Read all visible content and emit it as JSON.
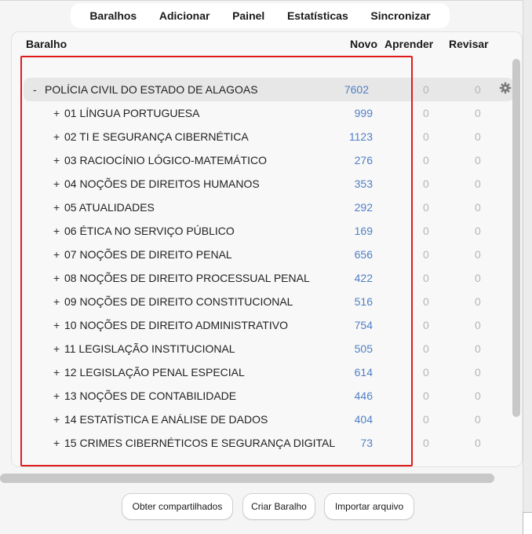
{
  "toolbar": {
    "items": [
      "Baralhos",
      "Adicionar",
      "Painel",
      "Estatísticas",
      "Sincronizar"
    ]
  },
  "table": {
    "headers": {
      "deck": "Baralho",
      "new": "Novo",
      "learn": "Aprender",
      "review": "Revisar"
    },
    "parent": {
      "toggle": "-",
      "name": "POLÍCIA CIVIL DO ESTADO DE ALAGOAS",
      "new": "7602",
      "learn": "0",
      "review": "0",
      "options_icon": "gear-icon"
    },
    "rows": [
      {
        "toggle": "+",
        "name": "01 LÍNGUA PORTUGUESA",
        "new": "999",
        "learn": "0",
        "review": "0"
      },
      {
        "toggle": "+",
        "name": "02 TI E SEGURANÇA CIBERNÉTICA",
        "new": "1123",
        "learn": "0",
        "review": "0"
      },
      {
        "toggle": "+",
        "name": "03 RACIOCÍNIO LÓGICO-MATEMÁTICO",
        "new": "276",
        "learn": "0",
        "review": "0"
      },
      {
        "toggle": "+",
        "name": "04 NOÇÕES DE DIREITOS HUMANOS",
        "new": "353",
        "learn": "0",
        "review": "0"
      },
      {
        "toggle": "+",
        "name": "05 ATUALIDADES",
        "new": "292",
        "learn": "0",
        "review": "0"
      },
      {
        "toggle": "+",
        "name": "06 ÉTICA NO SERVIÇO PÚBLICO",
        "new": "169",
        "learn": "0",
        "review": "0"
      },
      {
        "toggle": "+",
        "name": "07 NOÇÕES DE DIREITO PENAL",
        "new": "656",
        "learn": "0",
        "review": "0"
      },
      {
        "toggle": "+",
        "name": "08 NOÇÕES DE DIREITO PROCESSUAL PENAL",
        "new": "422",
        "learn": "0",
        "review": "0"
      },
      {
        "toggle": "+",
        "name": "09 NOÇÕES DE DIREITO CONSTITUCIONAL",
        "new": "516",
        "learn": "0",
        "review": "0"
      },
      {
        "toggle": "+",
        "name": "10 NOÇÕES DE DIREITO ADMINISTRATIVO",
        "new": "754",
        "learn": "0",
        "review": "0"
      },
      {
        "toggle": "+",
        "name": "11 LEGISLAÇÃO INSTITUCIONAL",
        "new": "505",
        "learn": "0",
        "review": "0"
      },
      {
        "toggle": "+",
        "name": "12 LEGISLAÇÃO PENAL ESPECIAL",
        "new": "614",
        "learn": "0",
        "review": "0"
      },
      {
        "toggle": "+",
        "name": "13 NOÇÕES DE CONTABILIDADE",
        "new": "446",
        "learn": "0",
        "review": "0"
      },
      {
        "toggle": "+",
        "name": "14 ESTATÍSTICA E ANÁLISE DE DADOS",
        "new": "404",
        "learn": "0",
        "review": "0"
      },
      {
        "toggle": "+",
        "name": "15 CRIMES CIBERNÉTICOS E SEGURANÇA DIGITAL",
        "new": "73",
        "learn": "0",
        "review": "0"
      }
    ]
  },
  "footer": {
    "shared_button": "Obter compartilhados",
    "create_button": "Criar Baralho",
    "import_button": "Importar arquivo"
  },
  "colors": {
    "new_count": "#4f7fc4",
    "zero_count": "#b5b5b5",
    "highlight_box": "#e01b1b",
    "parent_row_bg": "#e7e7e7"
  }
}
